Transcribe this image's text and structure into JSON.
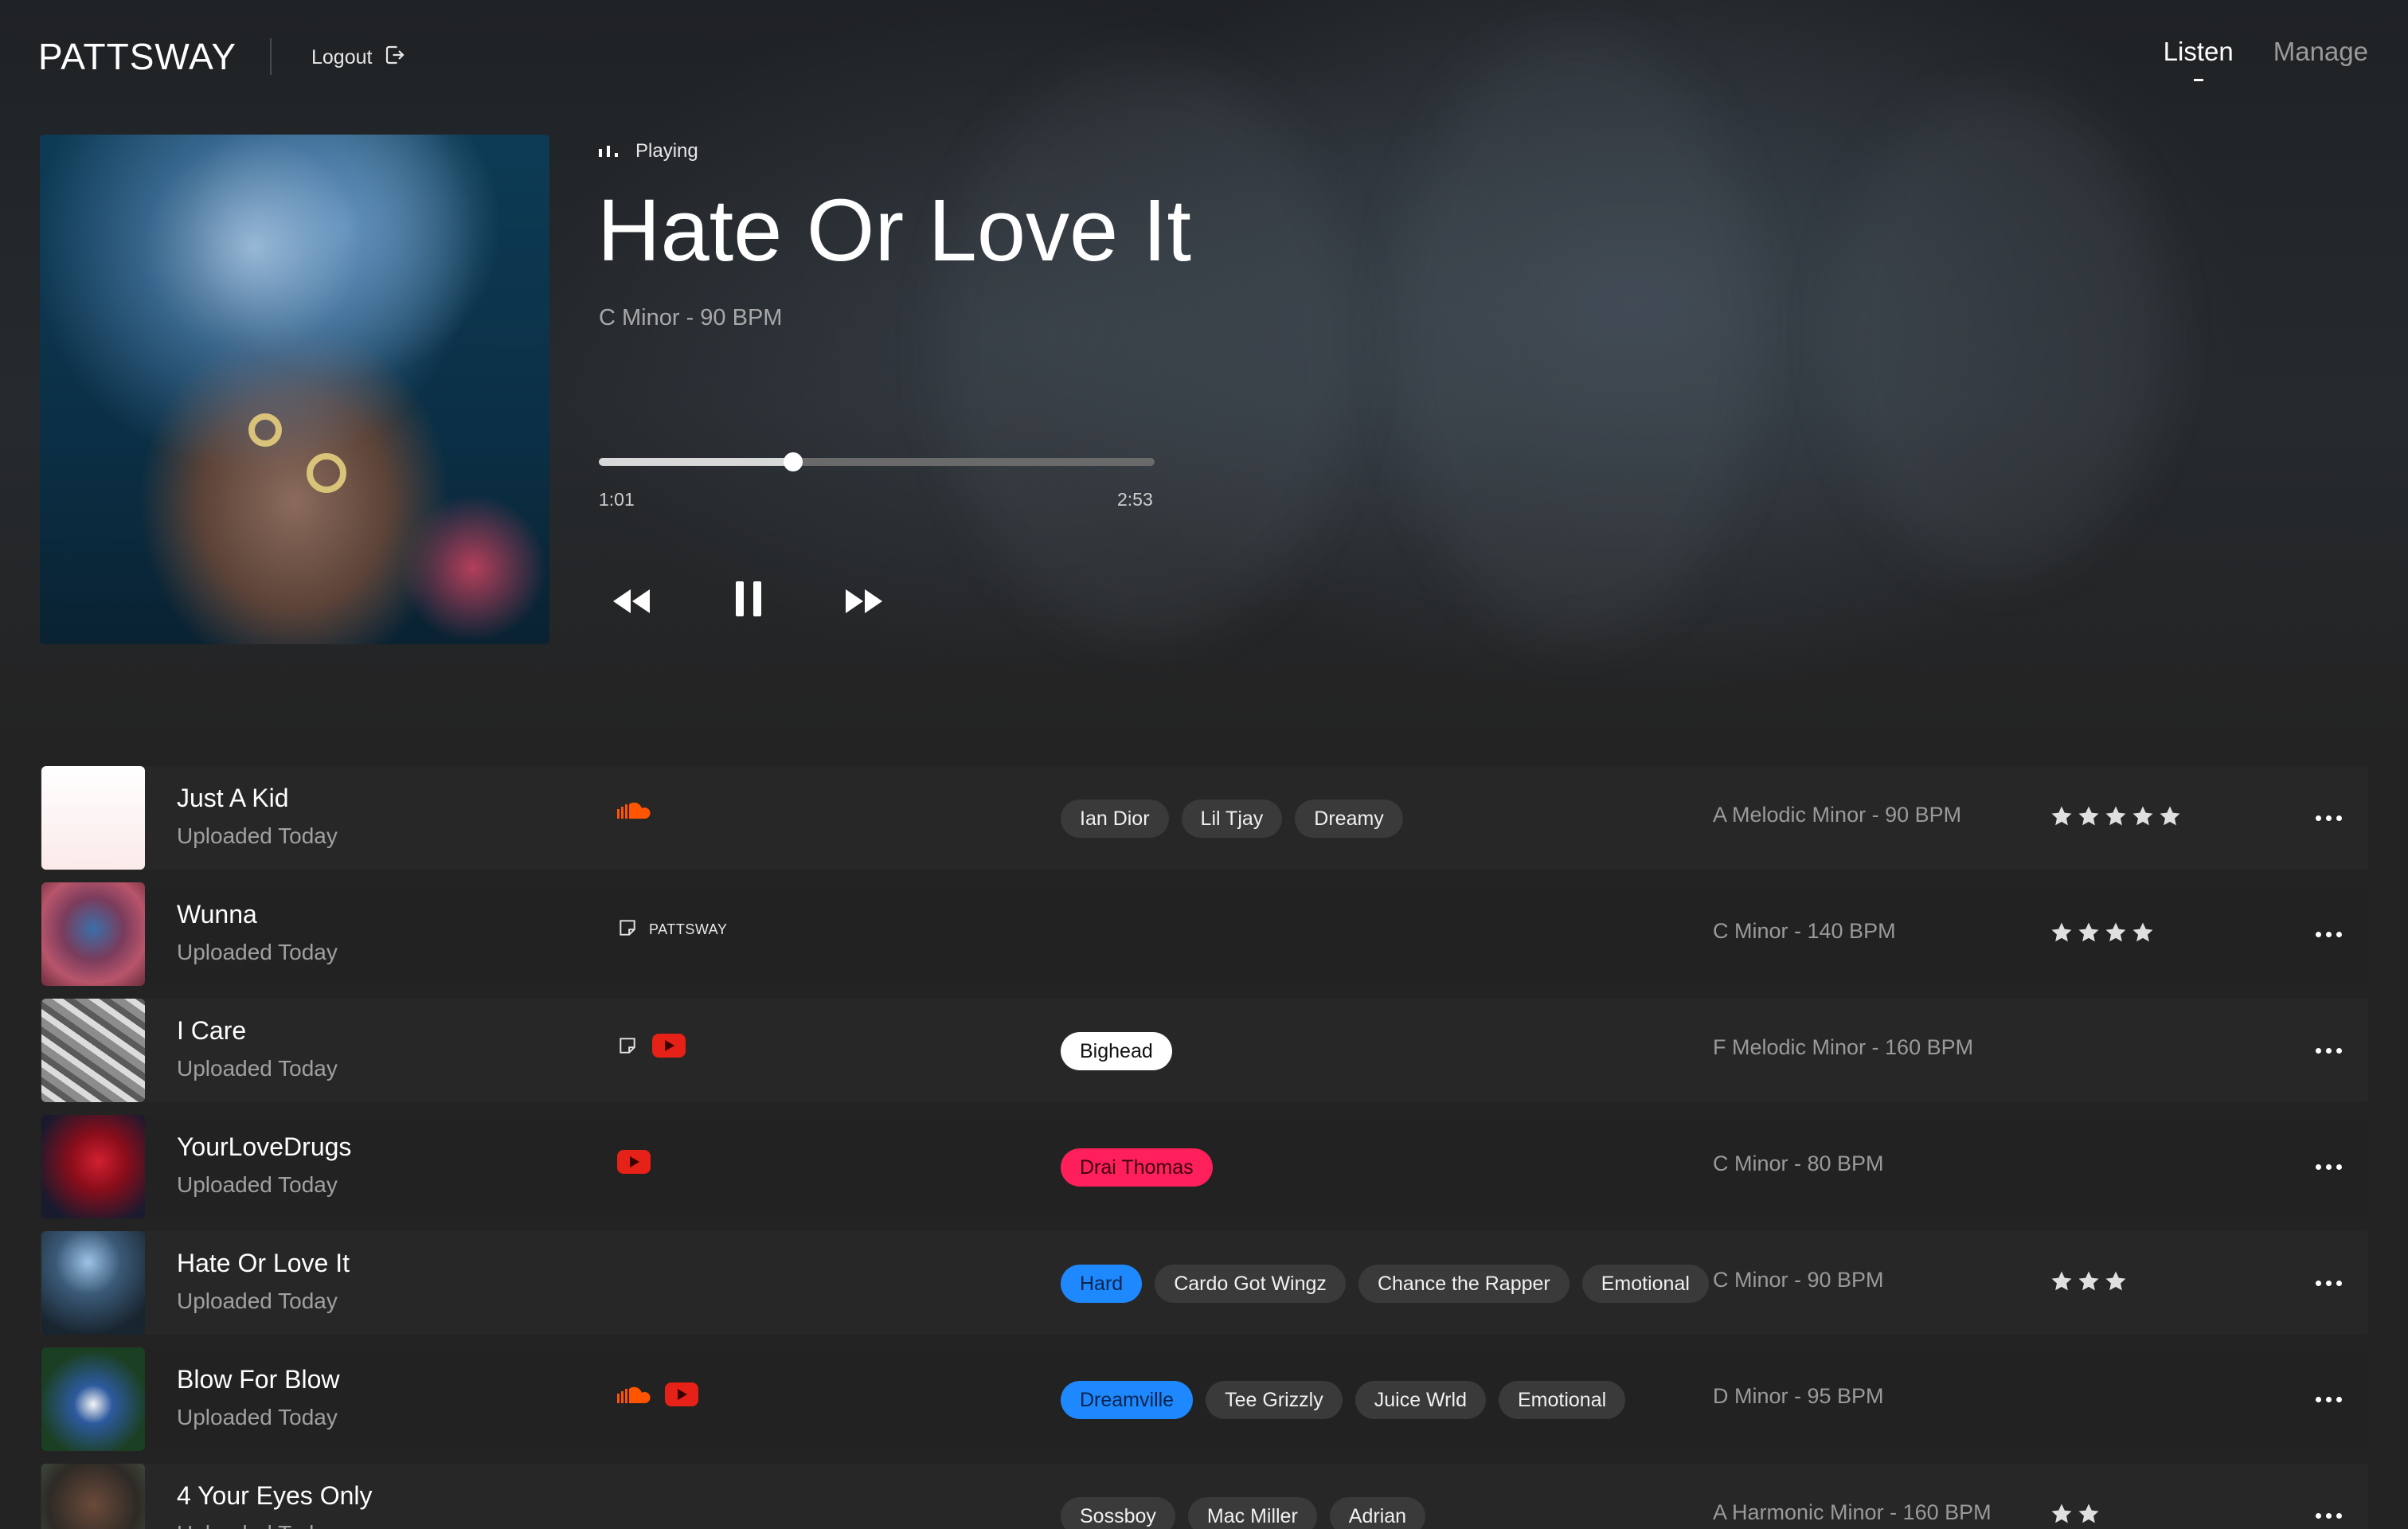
{
  "header": {
    "brand": "PATTSWAY",
    "logout_label": "Logout",
    "tabs": [
      {
        "label": "Listen",
        "active": true
      },
      {
        "label": "Manage",
        "active": false
      }
    ]
  },
  "now_playing": {
    "status": "Playing",
    "title": "Hate Or Love It",
    "meta": "C Minor - 90 BPM",
    "elapsed": "1:01",
    "duration": "2:53",
    "progress_fraction": 0.35
  },
  "tracks": [
    {
      "title": "Just A Kid",
      "subtitle": "Uploaded Today",
      "sources": [
        "soundcloud-icon"
      ],
      "source_label": "",
      "tags": [
        {
          "label": "Ian Dior",
          "color": "#3a3a3a",
          "text": "#f0f0f0"
        },
        {
          "label": "Lil Tjay",
          "color": "#3a3a3a",
          "text": "#f0f0f0"
        },
        {
          "label": "Dreamy",
          "color": "#3a3a3a",
          "text": "#f0f0f0"
        }
      ],
      "key": "A Melodic Minor - 90 BPM",
      "rating": 5
    },
    {
      "title": "Wunna",
      "subtitle": "Uploaded Today",
      "sources": [
        "note-icon"
      ],
      "source_label": "PATTSWAY",
      "tags": [],
      "key": "C Minor - 140 BPM",
      "rating": 4
    },
    {
      "title": "I Care",
      "subtitle": "Uploaded Today",
      "sources": [
        "note-icon",
        "youtube-icon"
      ],
      "source_label": "",
      "tags": [
        {
          "label": "Bighead",
          "color": "#ffffff",
          "text": "#111111"
        }
      ],
      "key": "F Melodic Minor - 160 BPM",
      "rating": 0
    },
    {
      "title": "YourLoveDrugs",
      "subtitle": "Uploaded Today",
      "sources": [
        "youtube-icon"
      ],
      "source_label": "",
      "tags": [
        {
          "label": "Drai Thomas",
          "color": "#ff1f5a",
          "text": "#3b0010"
        }
      ],
      "key": "C Minor - 80 BPM",
      "rating": 0
    },
    {
      "title": "Hate Or Love It",
      "subtitle": "Uploaded Today",
      "sources": [],
      "source_label": "",
      "tags": [
        {
          "label": "Hard",
          "color": "#1e88ff",
          "text": "#06254d"
        },
        {
          "label": "Cardo Got Wingz",
          "color": "#3a3a3a",
          "text": "#f0f0f0"
        },
        {
          "label": "Chance the Rapper",
          "color": "#3a3a3a",
          "text": "#f0f0f0"
        },
        {
          "label": "Emotional",
          "color": "#3a3a3a",
          "text": "#f0f0f0"
        }
      ],
      "key": "C Minor - 90 BPM",
      "rating": 3
    },
    {
      "title": "Blow For Blow",
      "subtitle": "Uploaded Today",
      "sources": [
        "soundcloud-icon",
        "youtube-icon"
      ],
      "source_label": "",
      "tags": [
        {
          "label": "Dreamville",
          "color": "#1e88ff",
          "text": "#06254d"
        },
        {
          "label": "Tee Grizzly",
          "color": "#3a3a3a",
          "text": "#f0f0f0"
        },
        {
          "label": "Juice Wrld",
          "color": "#3a3a3a",
          "text": "#f0f0f0"
        },
        {
          "label": "Emotional",
          "color": "#3a3a3a",
          "text": "#f0f0f0"
        }
      ],
      "key": "D Minor - 95 BPM",
      "rating": 0
    },
    {
      "title": "4 Your Eyes Only",
      "subtitle": "Uploaded Today",
      "sources": [],
      "source_label": "",
      "tags": [
        {
          "label": "Sossboy",
          "color": "#3a3a3a",
          "text": "#f0f0f0"
        },
        {
          "label": "Mac Miller",
          "color": "#3a3a3a",
          "text": "#f0f0f0"
        },
        {
          "label": "Adrian",
          "color": "#3a3a3a",
          "text": "#f0f0f0"
        }
      ],
      "key": "A Harmonic Minor - 160 BPM",
      "rating": 2
    }
  ],
  "colors": {
    "background": "#232323",
    "soundcloud": "#ff5500",
    "youtube": "#e62117",
    "star": "#e0e0e0"
  }
}
